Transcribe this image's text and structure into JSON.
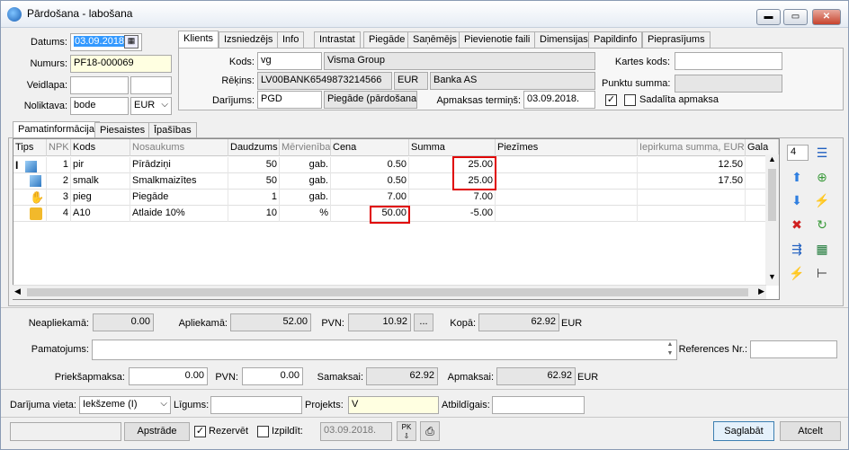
{
  "window": {
    "title": "Pārdošana - labošana",
    "min": "▬",
    "max": "▭",
    "close": "✕"
  },
  "header": {
    "datums_label": "Datums:",
    "datums_value": "03.09.2018",
    "numurs_label": "Numurs:",
    "numurs_value": "PF18-000069",
    "veidlapa_label": "Veidlapa:",
    "noliktava_label": "Noliktava:",
    "noliktava_value": "bode",
    "currency": "EUR"
  },
  "top_tabs": [
    "Klients",
    "Izsniedzējs",
    "Info",
    "Intrastat",
    "Piegāde",
    "Saņēmējs",
    "Pievienotie faili",
    "Dimensijas",
    "Papildinfo",
    "Pieprasījums"
  ],
  "client": {
    "kods_label": "Kods:",
    "kods_value": "vg",
    "kods_name": "Visma Group",
    "rekins_label": "Rēķins:",
    "rekins_value": "LV00BANK6549873214566",
    "rekins_cur": "EUR",
    "rekins_bank": "Banka AS",
    "darijums_label": "Darījums:",
    "darijums_value": "PGD",
    "darijums_name": "Piegāde (pārdošana)",
    "termins_label": "Apmaksas termiņš:",
    "termins_value": "03.09.2018.",
    "kartes_label": "Kartes kods:",
    "punktu_label": "Punktu summa:",
    "sadalita_label": "Sadalīta apmaksa",
    "check_mark": "✓"
  },
  "sub_tabs": [
    "Pamatinformācija",
    "Piesaistes",
    "Īpašības"
  ],
  "table": {
    "columns": [
      "Tips",
      "NPK",
      "Kods",
      "Nosaukums",
      "Daudzums",
      "Mērvienība",
      "Cena",
      "Summa",
      "Piezīmes",
      "Iepirkuma summa, EUR",
      "Gala"
    ],
    "rows": [
      {
        "npk": "1",
        "kods": "pir",
        "nosaukums": "Pīrādziņi",
        "daudzums": "50",
        "merv": "gab.",
        "cena": "0.50",
        "summa": "25.00",
        "iepirk": "12.50"
      },
      {
        "npk": "2",
        "kods": "smalk",
        "nosaukums": "Smalkmaizītes",
        "daudzums": "50",
        "merv": "gab.",
        "cena": "0.50",
        "summa": "25.00",
        "iepirk": "17.50"
      },
      {
        "npk": "3",
        "kods": "pieg",
        "nosaukums": "Piegāde",
        "daudzums": "1",
        "merv": "gab.",
        "cena": "7.00",
        "summa": "7.00",
        "iepirk": ""
      },
      {
        "npk": "4",
        "kods": "A10",
        "nosaukums": "Atlaide 10%",
        "daudzums": "10",
        "merv": "%",
        "cena": "50.00",
        "summa": "-5.00",
        "iepirk": ""
      }
    ],
    "row_marker": "I"
  },
  "side": {
    "count": "4"
  },
  "totals": {
    "neapliek_label": "Neapliekamā:",
    "neapliek_value": "0.00",
    "apliek_label": "Apliekamā:",
    "apliek_value": "52.00",
    "pvn_label": "PVN:",
    "pvn_value": "10.92",
    "pvn_btn": "...",
    "kopa_label": "Kopā:",
    "kopa_value": "62.92",
    "kopa_cur": "EUR"
  },
  "pamatojums_label": "Pamatojums:",
  "references_label": "References Nr.:",
  "prepay": {
    "label": "Priekšapmaksa:",
    "value": "0.00",
    "pvn_label": "PVN:",
    "pvn_value": "0.00",
    "samaksai_label": "Samaksai:",
    "samaksai_value": "62.92",
    "apmaksai_label": "Apmaksai:",
    "apmaksai_value": "62.92",
    "cur": "EUR"
  },
  "bottom": {
    "vieta_label": "Darījuma vieta:",
    "vieta_value": "Iekšzeme (I)",
    "ligums_label": "Līgums:",
    "projekts_label": "Projekts:",
    "projekts_value": "V",
    "atbildigais_label": "Atbildīgais:"
  },
  "footer": {
    "apstrade": "Apstrāde",
    "rezervet": "Rezervēt",
    "izpildit": "Izpildīt:",
    "izpildit_date": "03.09.2018.",
    "saglabat": "Saglabāt",
    "atcelt": "Atcelt"
  }
}
